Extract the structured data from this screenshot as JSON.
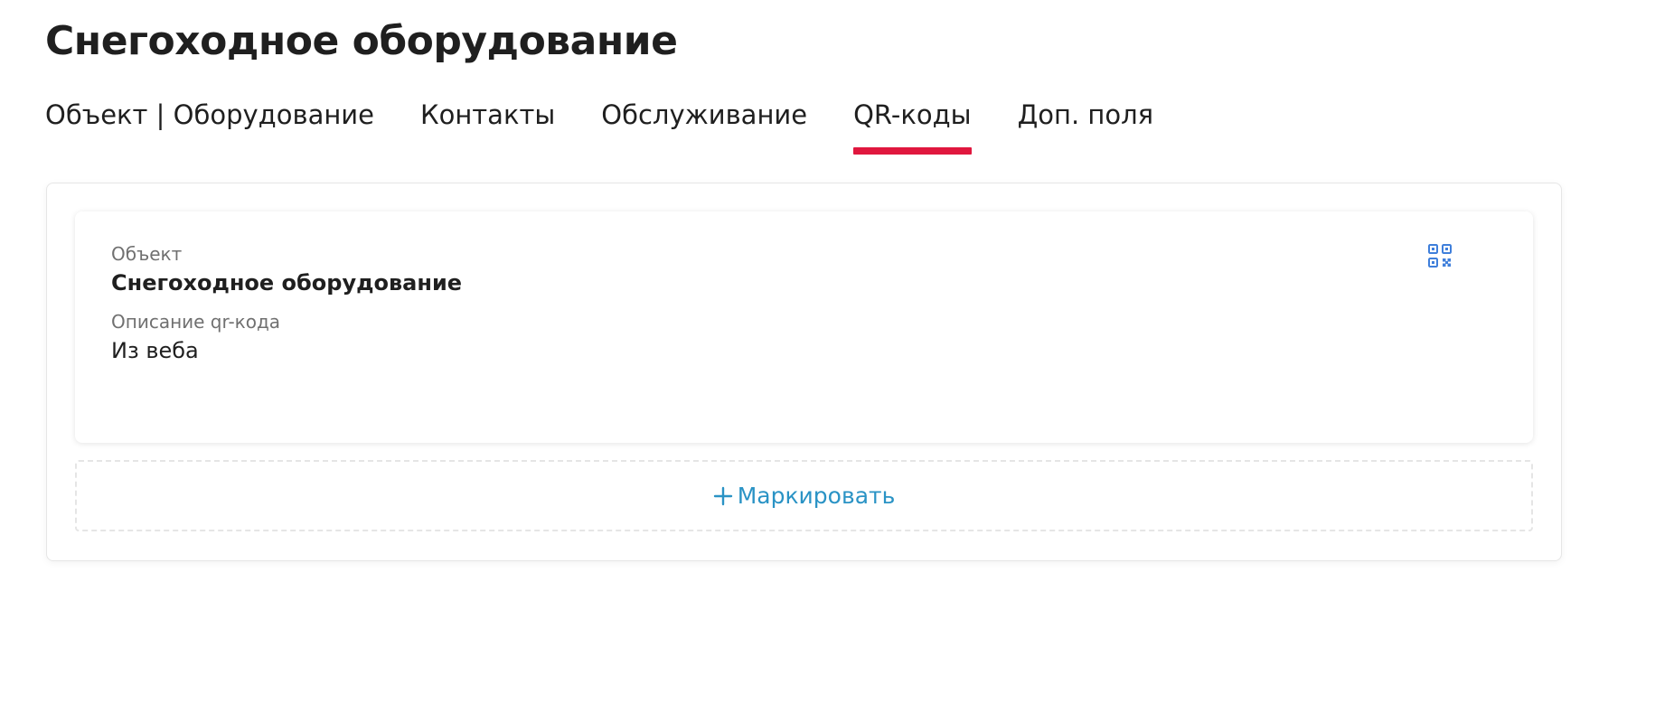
{
  "page": {
    "title": "Снегоходное оборудование"
  },
  "tabs": [
    {
      "label": "Объект | Оборудование",
      "active": false
    },
    {
      "label": "Контакты",
      "active": false
    },
    {
      "label": "Обслуживание",
      "active": false
    },
    {
      "label": "QR-коды",
      "active": true
    },
    {
      "label": "Доп. поля",
      "active": false
    }
  ],
  "qr_card": {
    "object_label": "Объект",
    "object_value": "Снегоходное оборудование",
    "description_label": "Описание qr-кода",
    "description_value": "Из веба",
    "icon": "qr-code-icon"
  },
  "actions": {
    "mark_label": "Маркировать",
    "mark_icon": "plus-icon"
  },
  "colors": {
    "active_tab_underline": "#e0173e",
    "accent": "#2a93c5",
    "qr_icon": "#3f7fdb"
  }
}
